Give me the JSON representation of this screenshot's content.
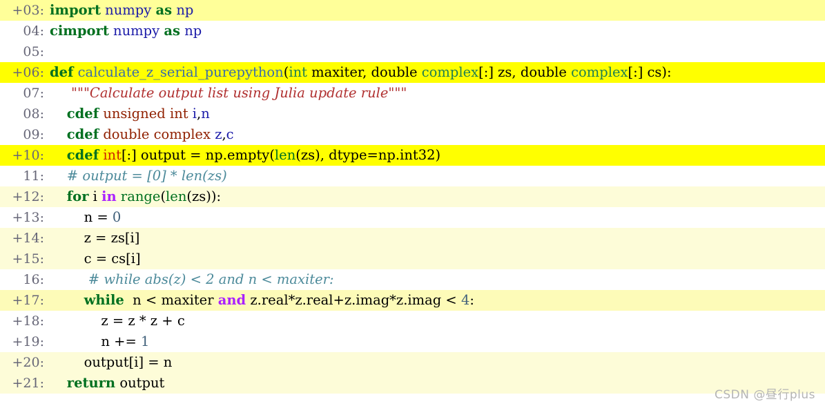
{
  "view": {
    "kind": "cython-annotated-source",
    "watermark": "CSDN @昼行plus",
    "colors": {
      "background": "#ffffff",
      "highlight_strong": "#ffff00",
      "highlight_medium": "#ffff99",
      "highlight_light": "#fdfcd8",
      "keyword": "#007020",
      "operator_word": "#aa22ff",
      "c_type": "#902000",
      "cython_type": "#208050",
      "function_name": "#3b6ea8",
      "builtin": "#007020",
      "variable": "#1a1aa8",
      "number": "#40607a",
      "docstring": "#b03030",
      "comment": "#4c8a9a",
      "gutter_text": "#666677"
    }
  },
  "lines": [
    {
      "marker": "+",
      "number": "03",
      "gutter": "+03:",
      "highlight": 4,
      "text": "import numpy as np",
      "tokens": [
        {
          "t": "import",
          "c": "t-kw"
        },
        {
          "t": " ",
          "c": "t-plain"
        },
        {
          "t": "numpy",
          "c": "t-name"
        },
        {
          "t": " ",
          "c": "t-plain"
        },
        {
          "t": "as",
          "c": "t-kw"
        },
        {
          "t": " ",
          "c": "t-plain"
        },
        {
          "t": "np",
          "c": "t-name"
        }
      ]
    },
    {
      "marker": "",
      "number": "04",
      "gutter": "04:",
      "highlight": 0,
      "text": "cimport numpy as np",
      "tokens": [
        {
          "t": "cimport",
          "c": "t-kw"
        },
        {
          "t": " ",
          "c": "t-plain"
        },
        {
          "t": "numpy",
          "c": "t-name"
        },
        {
          "t": " ",
          "c": "t-plain"
        },
        {
          "t": "as",
          "c": "t-kw"
        },
        {
          "t": " ",
          "c": "t-plain"
        },
        {
          "t": "np",
          "c": "t-name"
        }
      ]
    },
    {
      "marker": "",
      "number": "05",
      "gutter": "05:",
      "highlight": 0,
      "text": "",
      "tokens": []
    },
    {
      "marker": "+",
      "number": "06",
      "gutter": "+06:",
      "highlight": 5,
      "text": "def calculate_z_serial_purepython(int maxiter, double complex[:] zs, double complex[:] cs):",
      "tokens": [
        {
          "t": "def",
          "c": "t-kw"
        },
        {
          "t": " ",
          "c": "t-plain"
        },
        {
          "t": "calculate_z_serial_purepython",
          "c": "t-fn"
        },
        {
          "t": "(",
          "c": "t-punc"
        },
        {
          "t": "int",
          "c": "t-ctype"
        },
        {
          "t": " maxiter, ",
          "c": "t-plain"
        },
        {
          "t": "double",
          "c": "t-plain"
        },
        {
          "t": " ",
          "c": "t-plain"
        },
        {
          "t": "complex",
          "c": "t-ctype"
        },
        {
          "t": "[:] zs, ",
          "c": "t-plain"
        },
        {
          "t": "double",
          "c": "t-plain"
        },
        {
          "t": " ",
          "c": "t-plain"
        },
        {
          "t": "complex",
          "c": "t-ctype"
        },
        {
          "t": "[:] cs):",
          "c": "t-plain"
        }
      ]
    },
    {
      "marker": "",
      "number": "07",
      "gutter": "07:",
      "highlight": 0,
      "text": "    \"\"\"Calculate output list using Julia update rule\"\"\"",
      "tokens": [
        {
          "t": "     ",
          "c": "t-plain"
        },
        {
          "t": "\"\"\"Calculate output list using Julia update rule\"\"\"",
          "c": "t-str"
        }
      ]
    },
    {
      "marker": "",
      "number": "08",
      "gutter": "08:",
      "highlight": 0,
      "text": "    cdef unsigned int i,n",
      "tokens": [
        {
          "t": "    ",
          "c": "t-plain"
        },
        {
          "t": "cdef",
          "c": "t-kw"
        },
        {
          "t": " ",
          "c": "t-plain"
        },
        {
          "t": "unsigned",
          "c": "t-type"
        },
        {
          "t": " ",
          "c": "t-plain"
        },
        {
          "t": "int",
          "c": "t-type"
        },
        {
          "t": " ",
          "c": "t-plain"
        },
        {
          "t": "i",
          "c": "t-name"
        },
        {
          "t": ",",
          "c": "t-punc"
        },
        {
          "t": "n",
          "c": "t-name"
        }
      ]
    },
    {
      "marker": "",
      "number": "09",
      "gutter": "09:",
      "highlight": 0,
      "text": "    cdef double complex z,c",
      "tokens": [
        {
          "t": "    ",
          "c": "t-plain"
        },
        {
          "t": "cdef",
          "c": "t-kw"
        },
        {
          "t": " ",
          "c": "t-plain"
        },
        {
          "t": "double",
          "c": "t-type"
        },
        {
          "t": " ",
          "c": "t-plain"
        },
        {
          "t": "complex",
          "c": "t-type"
        },
        {
          "t": " ",
          "c": "t-plain"
        },
        {
          "t": "z",
          "c": "t-name"
        },
        {
          "t": ",",
          "c": "t-punc"
        },
        {
          "t": "c",
          "c": "t-name"
        }
      ]
    },
    {
      "marker": "+",
      "number": "10",
      "gutter": "+10:",
      "highlight": 5,
      "text": "    cdef int[:] output = np.empty(len(zs), dtype=np.int32)",
      "tokens": [
        {
          "t": "    ",
          "c": "t-plain"
        },
        {
          "t": "cdef",
          "c": "t-kw"
        },
        {
          "t": " ",
          "c": "t-plain"
        },
        {
          "t": "int",
          "c": "t-red"
        },
        {
          "t": "[:] output = np.",
          "c": "t-plain"
        },
        {
          "t": "empty",
          "c": "t-plain"
        },
        {
          "t": "(",
          "c": "t-punc"
        },
        {
          "t": "len",
          "c": "t-bfn"
        },
        {
          "t": "(zs), dtype=np.int32)",
          "c": "t-plain"
        }
      ]
    },
    {
      "marker": "",
      "number": "11",
      "gutter": "11:",
      "highlight": 0,
      "text": "    # output = [0] * len(zs)",
      "tokens": [
        {
          "t": "    ",
          "c": "t-plain"
        },
        {
          "t": "# output = [0] * len(zs)",
          "c": "t-cmt"
        }
      ]
    },
    {
      "marker": "+",
      "number": "12",
      "gutter": "+12:",
      "highlight": 2,
      "text": "    for i in range(len(zs)):",
      "tokens": [
        {
          "t": "    ",
          "c": "t-plain"
        },
        {
          "t": "for",
          "c": "t-kw"
        },
        {
          "t": " i ",
          "c": "t-plain"
        },
        {
          "t": "in",
          "c": "t-op"
        },
        {
          "t": " ",
          "c": "t-plain"
        },
        {
          "t": "range",
          "c": "t-bfn"
        },
        {
          "t": "(",
          "c": "t-punc"
        },
        {
          "t": "len",
          "c": "t-bfn"
        },
        {
          "t": "(zs)):",
          "c": "t-plain"
        }
      ]
    },
    {
      "marker": "+",
      "number": "13",
      "gutter": "+13:",
      "highlight": 0,
      "text": "        n = 0",
      "tokens": [
        {
          "t": "        n = ",
          "c": "t-plain"
        },
        {
          "t": "0",
          "c": "t-num"
        }
      ]
    },
    {
      "marker": "+",
      "number": "14",
      "gutter": "+14:",
      "highlight": 2,
      "text": "        z = zs[i]",
      "tokens": [
        {
          "t": "        z = zs[i]",
          "c": "t-plain"
        }
      ]
    },
    {
      "marker": "+",
      "number": "15",
      "gutter": "+15:",
      "highlight": 2,
      "text": "        c = cs[i]",
      "tokens": [
        {
          "t": "        c = cs[i]",
          "c": "t-plain"
        }
      ]
    },
    {
      "marker": "",
      "number": "16",
      "gutter": "16:",
      "highlight": 0,
      "text": "         # while abs(z) < 2 and n < maxiter:",
      "tokens": [
        {
          "t": "         ",
          "c": "t-plain"
        },
        {
          "t": "# while abs(z) < 2 and n < maxiter:",
          "c": "t-cmt"
        }
      ]
    },
    {
      "marker": "+",
      "number": "17",
      "gutter": "+17:",
      "highlight": 3,
      "text": "        while  n < maxiter and z.real*z.real+z.imag*z.imag < 4:",
      "tokens": [
        {
          "t": "        ",
          "c": "t-plain"
        },
        {
          "t": "while",
          "c": "t-kw"
        },
        {
          "t": "  n < maxiter ",
          "c": "t-plain"
        },
        {
          "t": "and",
          "c": "t-op"
        },
        {
          "t": " z.real*z.real+z.imag*z.imag < ",
          "c": "t-plain"
        },
        {
          "t": "4",
          "c": "t-num"
        },
        {
          "t": ":",
          "c": "t-punc"
        }
      ]
    },
    {
      "marker": "+",
      "number": "18",
      "gutter": "+18:",
      "highlight": 0,
      "text": "            z = z * z + c",
      "tokens": [
        {
          "t": "            z = z * z + c",
          "c": "t-plain"
        }
      ]
    },
    {
      "marker": "+",
      "number": "19",
      "gutter": "+19:",
      "highlight": 0,
      "text": "            n += 1",
      "tokens": [
        {
          "t": "            n += ",
          "c": "t-plain"
        },
        {
          "t": "1",
          "c": "t-num"
        }
      ]
    },
    {
      "marker": "+",
      "number": "20",
      "gutter": "+20:",
      "highlight": 2,
      "text": "        output[i] = n",
      "tokens": [
        {
          "t": "        output[i] = n",
          "c": "t-plain"
        }
      ]
    },
    {
      "marker": "+",
      "number": "21",
      "gutter": "+21:",
      "highlight": 2,
      "text": "    return output",
      "tokens": [
        {
          "t": "    ",
          "c": "t-plain"
        },
        {
          "t": "return",
          "c": "t-kw"
        },
        {
          "t": " output",
          "c": "t-plain"
        }
      ]
    }
  ]
}
